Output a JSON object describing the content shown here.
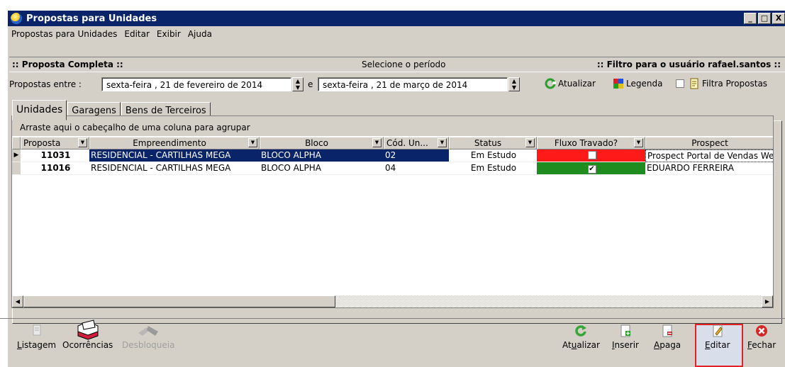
{
  "window": {
    "title": "Propostas para Unidades",
    "buttons": [
      "_",
      "□",
      "X"
    ]
  },
  "menu": [
    "Propostas para Unidades",
    "Editar",
    "Exibir",
    "Ajuda"
  ],
  "header": {
    "left": ":: Proposta Completa ::",
    "center": "Selecione o período",
    "right": ":: Filtro para o usuário rafael.santos ::"
  },
  "period": {
    "label": "Propostas entre :",
    "start": "sexta-feira  , 21 de fevereiro de 2014",
    "joiner": "e",
    "end": "sexta-feira  , 21 de   março   de 2014"
  },
  "toolbar": {
    "refresh": "Atualizar",
    "legend": "Legenda",
    "filter": "Filtra Propostas"
  },
  "tabs": [
    "Unidades",
    "Garagens",
    "Bens de Terceiros"
  ],
  "grid": {
    "group_hint": "Arraste aqui o cabeçalho de uma coluna para agrupar",
    "columns": [
      "Proposta",
      "Empreendimento",
      "Bloco",
      "Cód. Un...",
      "Status",
      "Fluxo Travado?",
      "Prospect"
    ],
    "rows": [
      {
        "proposta": "11031",
        "empreendimento": "RESIDENCIAL - CARTILHAS MEGA",
        "bloco": "BLOCO ALPHA",
        "cod": "02",
        "status": "Em Estudo",
        "fluxo_travado": false,
        "fluxo_color": "#ff1a1a",
        "prospect": "Prospect Portal de Vendas Web"
      },
      {
        "proposta": "11016",
        "empreendimento": "RESIDENCIAL - CARTILHAS MEGA",
        "bloco": "BLOCO ALPHA",
        "cod": "04",
        "status": "Em Estudo",
        "fluxo_travado": true,
        "fluxo_color": "#1e8c1e",
        "prospect": "EDUARDO FERREIRA"
      }
    ]
  },
  "bottom_left": {
    "listagem": "Listagem",
    "ocorrencias": "Ocorrências",
    "desbloqueia": "Desbloqueia"
  },
  "bottom_right": {
    "atualizar": "Atualizar",
    "inserir": "Inserir",
    "apaga": "Apaga",
    "editar": "Editar",
    "fechar": "Fechar"
  },
  "colors": {
    "titlebar": "#0a246a",
    "selection": "#0a246a",
    "highlight_frame": "#e32127"
  }
}
